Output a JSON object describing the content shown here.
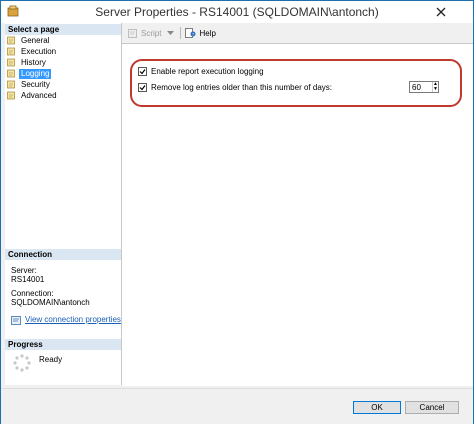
{
  "window": {
    "title": "Server Properties - RS14001 (SQLDOMAIN\\antonch)"
  },
  "left": {
    "select_page_header": "Select a page",
    "pages": [
      {
        "label": "General",
        "selected": false
      },
      {
        "label": "Execution",
        "selected": false
      },
      {
        "label": "History",
        "selected": false
      },
      {
        "label": "Logging",
        "selected": true
      },
      {
        "label": "Security",
        "selected": false
      },
      {
        "label": "Advanced",
        "selected": false
      }
    ],
    "connection_header": "Connection",
    "server_label": "Server:",
    "server_value": "RS14001",
    "connection_label": "Connection:",
    "connection_value": "SQLDOMAIN\\antonch",
    "view_link": "View connection properties",
    "progress_header": "Progress",
    "progress_status": "Ready"
  },
  "toolbar": {
    "script_label": "Script",
    "help_label": "Help"
  },
  "logging": {
    "enable_label": "Enable report execution logging",
    "enable_checked": true,
    "remove_label": "Remove log entries older than this number of days:",
    "remove_checked": true,
    "days_value": "60"
  },
  "buttons": {
    "ok": "OK",
    "cancel": "Cancel"
  },
  "colors": {
    "selection": "#3399ff",
    "highlight_border": "#c0392b",
    "link": "#1a5fb4"
  }
}
